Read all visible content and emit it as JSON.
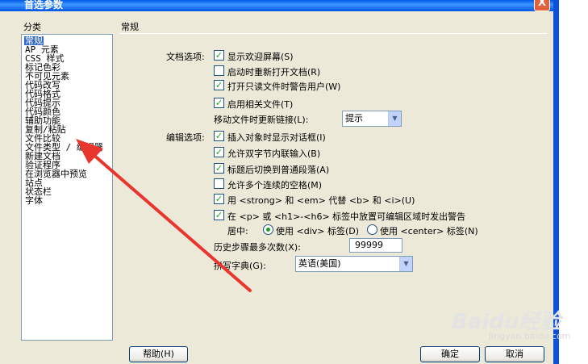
{
  "window": {
    "title": "首选参数",
    "close_label": "X"
  },
  "categories": {
    "label": "分类",
    "items": [
      "常规",
      "AP 元素",
      "CSS 样式",
      "标记色彩",
      "不可见元素",
      "代码改写",
      "代码格式",
      "代码提示",
      "代码颜色",
      "辅助功能",
      "复制/粘贴",
      "文件比较",
      "文件类型 / 编辑器",
      "新建文档",
      "验证程序",
      "在浏览器中预览",
      "站点",
      "状态栏",
      "字体"
    ]
  },
  "section_title": "常规",
  "doc_options": {
    "label": "文档选项:",
    "show_welcome": {
      "label": "显示欢迎屏幕(S)",
      "checked": true
    },
    "reopen_docs": {
      "label": "启动时重新打开文档(R)",
      "checked": false
    },
    "warn_readonly": {
      "label": "打开只读文件时警告用户(W)",
      "checked": true
    },
    "related_files": {
      "label": "启用相关文件(T)",
      "checked": true
    },
    "update_links": {
      "label": "移动文件时更新链接(L):",
      "value": "提示"
    }
  },
  "edit_options": {
    "label": "编辑选项:",
    "insert_dialog": {
      "label": "插入对象时显示对话框(I)",
      "checked": true
    },
    "double_byte": {
      "label": "允许双字节内联输入(B)",
      "checked": true
    },
    "switch_paragraph": {
      "label": "标题后切换到普通段落(A)",
      "checked": true
    },
    "multiple_spaces": {
      "label": "允许多个连续的空格(M)",
      "checked": false
    },
    "strong_em": {
      "label": "用 <strong> 和 <em> 代替 <b> 和 <i>(U)",
      "checked": true
    },
    "warn_p_h": {
      "label": "在 <p> 或 <h1>-<h6> 标签中放置可编辑区域时发出警告",
      "checked": true
    },
    "centering": {
      "label": "居中:",
      "use_div": {
        "label": "使用 <div> 标签(D)",
        "selected": true
      },
      "use_center": {
        "label": "使用 <center> 标签(N)",
        "selected": false
      }
    },
    "history": {
      "label": "历史步骤最多次数(X):",
      "value": "99999"
    },
    "spelling": {
      "label": "拼写字典(G):",
      "value": "英语(美国)"
    }
  },
  "buttons": {
    "help": "帮助(H)",
    "ok": "确定",
    "cancel": "取消"
  },
  "watermark": {
    "text": "Baidu经验",
    "sub": "jingyan.baidu.com"
  },
  "colors": {
    "arrow": "#e8352e",
    "selection": "#316ac5",
    "check": "#21a121"
  }
}
